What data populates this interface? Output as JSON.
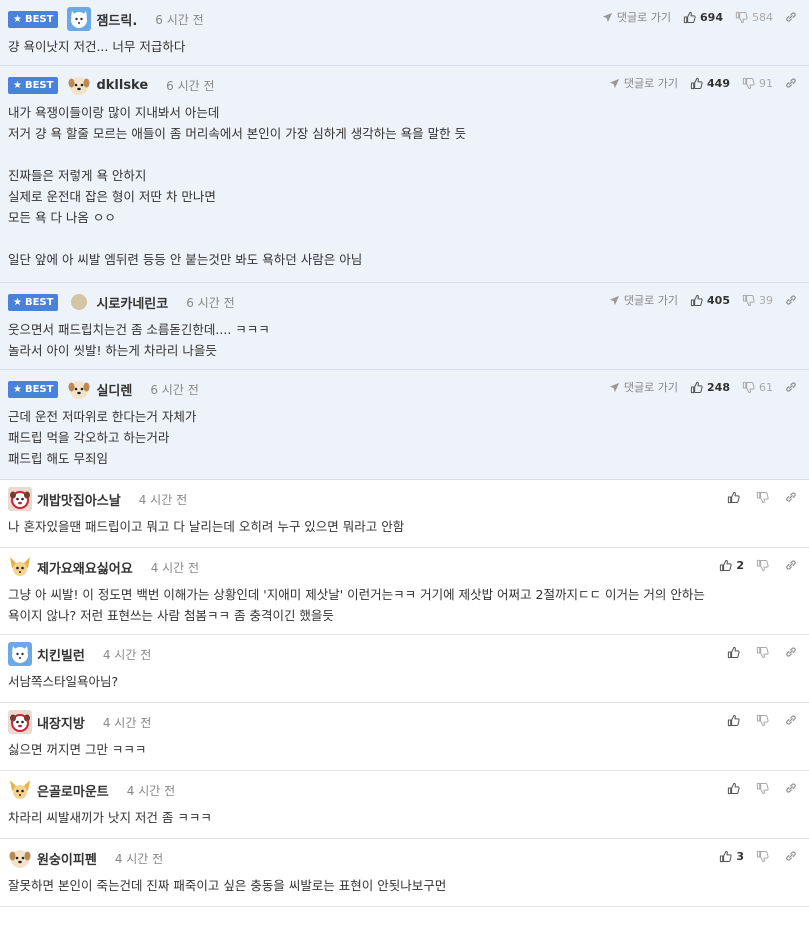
{
  "labels": {
    "best": "BEST",
    "reply": "댓글로 가기"
  },
  "best_comments": [
    {
      "nick": "잼드릭.",
      "time": "6 시간 전",
      "avatar": "blue-fox",
      "up": "694",
      "down": "584",
      "lines": [
        "걍 욕이낫지 저건... 너무 저급하다"
      ]
    },
    {
      "nick": "dkllske",
      "time": "6 시간 전",
      "avatar": "puppy",
      "up": "449",
      "down": "91",
      "lines": [
        "내가 욕쟁이들이랑 많이 지내봐서 아는데",
        "저거 걍 욕 할줄 모르는 애들이 좀 머리속에서 본인이 가장 심하게 생각하는 욕을 말한 듯",
        "",
        "진짜들은 저렇게 욕 안하지",
        "실제로 운전대 잡은 형이 저딴 차 만나면",
        "모든 욕 다 나옴 ㅇㅇ",
        "",
        "일단 앞에 아 씨발 엠뒤련 등등 안 붙는것만 봐도 욕하던 사람은 아님"
      ]
    },
    {
      "nick": "시로카네린코",
      "time": "6 시간 전",
      "avatar": "circle",
      "up": "405",
      "down": "39",
      "lines": [
        "웃으면서 패드립치는건 좀 소름돋긴한데.... ㅋㅋㅋ",
        "놀라서 아이 씻발! 하는게 차라리 나을듯"
      ]
    },
    {
      "nick": "실디렌",
      "time": "6 시간 전",
      "avatar": "puppy",
      "up": "248",
      "down": "61",
      "lines": [
        "근데 운전 저따위로 한다는거 자체가",
        "패드립 먹을 각오하고 하는거라",
        "패드립 해도 무죄임"
      ]
    }
  ],
  "comments": [
    {
      "nick": "개밥맛집아스날",
      "time": "4 시간 전",
      "avatar": "red-dog",
      "up": "",
      "lines": [
        "나 혼자있을땐 패드립이고 뭐고 다 날리는데 오히려 누구 있으면 뭐라고 안함"
      ]
    },
    {
      "nick": "제가요왜요싫어요",
      "time": "4 시간 전",
      "avatar": "fennec",
      "up": "2",
      "lines": [
        "그냥 아 씨발! 이 정도면 백번 이해가는 상황인데 '지애미 제삿날' 이런거는ㅋㅋ 거기에 제삿밥 어쩌고 2절까지ㄷㄷ 이거는 거의 안하는",
        "욕이지 않나? 저런 표현쓰는 사람 첨봄ㅋㅋ 좀 충격이긴 했을듯"
      ]
    },
    {
      "nick": "치킨빌런",
      "time": "4 시간 전",
      "avatar": "blue-fox",
      "up": "",
      "lines": [
        "서남쪽스타일욕아님?"
      ]
    },
    {
      "nick": "내장지방",
      "time": "4 시간 전",
      "avatar": "red-dog",
      "up": "",
      "lines": [
        "싫으면 꺼지면 그만 ㅋㅋㅋ"
      ]
    },
    {
      "nick": "은골로마운트",
      "time": "4 시간 전",
      "avatar": "fennec",
      "up": "",
      "lines": [
        "차라리 씨발새끼가 낫지 저건 좀 ㅋㅋㅋ"
      ]
    },
    {
      "nick": "원숭이피펜",
      "time": "4 시간 전",
      "avatar": "puppy",
      "up": "3",
      "lines": [
        "잘못하면 본인이 죽는건데 진짜 패죽이고 싶은 충동을 씨발로는 표현이 안됫나보구먼"
      ]
    }
  ],
  "colors": {
    "best_badge": "#4a81d9",
    "best_background": "#eef2f9"
  }
}
